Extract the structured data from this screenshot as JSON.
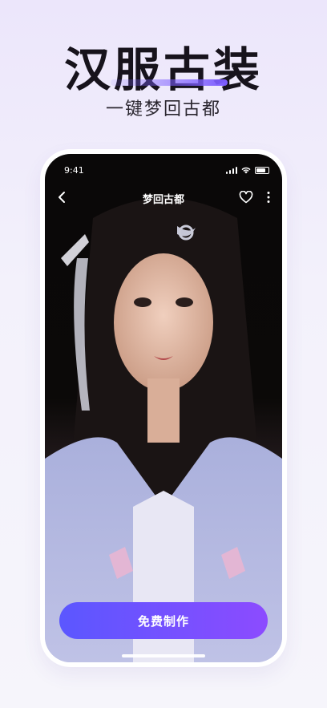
{
  "promo": {
    "title": "汉服古装",
    "subtitle": "一键梦回古都"
  },
  "status_bar": {
    "time": "9:41",
    "icons": [
      "signal-icon",
      "wifi-icon",
      "battery-icon"
    ]
  },
  "nav": {
    "title": "梦回古都",
    "icons": [
      "back-chevron-icon",
      "heart-icon",
      "more-vertical-icon"
    ]
  },
  "cta": {
    "label": "免费制作"
  },
  "colors": {
    "accent_start": "#5b57ff",
    "accent_end": "#8c4bff",
    "background": "#f3f1fb",
    "title_text": "#17131c"
  }
}
